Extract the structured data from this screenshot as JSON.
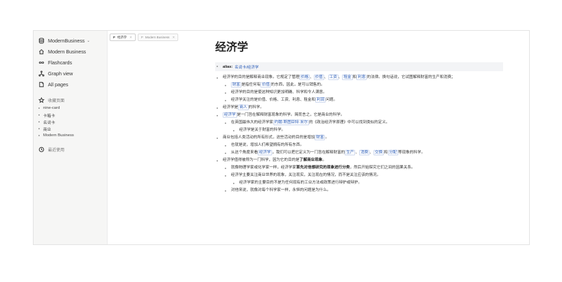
{
  "sidebar": {
    "workspace": "ModernBusiness",
    "items": [
      {
        "label": "Modern Business",
        "icon": "home-icon"
      },
      {
        "label": "Flashcards",
        "icon": "infinity-icon"
      },
      {
        "label": "Graph view",
        "icon": "graph-icon"
      },
      {
        "label": "All pages",
        "icon": "pages-icon"
      }
    ],
    "favorites_label": "收藏页面",
    "favorites": [
      "nine-card",
      "卡箱卡",
      "名词卡",
      "商业",
      "Modern Business"
    ],
    "recent_label": "最近使用"
  },
  "tabs": [
    {
      "prefix": "P",
      "label": "经济学",
      "active": true
    },
    {
      "prefix": "P",
      "label": "Modern Business",
      "active": false
    }
  ],
  "page": {
    "title": "经济学",
    "alias_key": "alias:",
    "alias_value": "名词卡/经济学",
    "blocks": [
      {
        "level": 0,
        "parts": [
          {
            "t": "经济学的目的是解释商业现象。它规定了管理"
          },
          {
            "t": "价格",
            "link": true
          },
          {
            "t": "、"
          },
          {
            "t": "价值",
            "link": true
          },
          {
            "t": "、"
          },
          {
            "t": "工资",
            "link": true
          },
          {
            "t": "、"
          },
          {
            "t": "租金",
            "link": true
          },
          {
            "t": "和"
          },
          {
            "t": "利息",
            "link": true
          },
          {
            "t": "的法律。换句话说，它试图解释财富的生产和消费；"
          }
        ]
      },
      {
        "level": 1,
        "parts": [
          {
            "t": "财富",
            "link": true
          },
          {
            "t": "是指任何有"
          },
          {
            "t": "价值",
            "link": true
          },
          {
            "t": "的东西，因此，是可以销售的。"
          }
        ]
      },
      {
        "level": 1,
        "parts": [
          {
            "t": "经济学的目的是使这种知识更加明确、科学和令人满意。"
          }
        ]
      },
      {
        "level": 1,
        "parts": [
          {
            "t": "经济学关注的是价值、价格、工资、利息、租金和"
          },
          {
            "t": "利润",
            "link": true
          },
          {
            "t": "问题。"
          }
        ]
      },
      {
        "level": 0,
        "parts": [
          {
            "t": "经济学是"
          },
          {
            "t": "商人",
            "link": true
          },
          {
            "t": "的科学。"
          }
        ]
      },
      {
        "level": 0,
        "parts": [
          {
            "t": "经济学",
            "link": true
          },
          {
            "t": "是一门旨在解释财富现象的科学。简而言之，它是商业的科学。"
          }
        ]
      },
      {
        "level": 1,
        "parts": [
          {
            "t": "在英国最伟大的经济学家"
          },
          {
            "t": "约翰·斯图亚特·米尔",
            "link": true
          },
          {
            "t": "的《政治经济学原理》中可以找到类似的定义。"
          }
        ]
      },
      {
        "level": 2,
        "parts": [
          {
            "t": "经济学是关于财富的科学。"
          }
        ]
      },
      {
        "level": 0,
        "parts": [
          {
            "t": "商业包括人类活动的所有形式，这些活动的目的是增加"
          },
          {
            "t": "财富",
            "link": true
          },
          {
            "t": "。"
          }
        ]
      },
      {
        "level": 1,
        "parts": [
          {
            "t": "也就是说，增加人们希望拥有的所有东西。"
          }
        ]
      },
      {
        "level": 1,
        "parts": [
          {
            "t": "从这个角度来看"
          },
          {
            "t": "经济学",
            "link": true
          },
          {
            "t": "，我们可以把它定义为一门旨在解释财富的"
          },
          {
            "t": "生产",
            "link": true
          },
          {
            "t": "、"
          },
          {
            "t": "消费",
            "link": true
          },
          {
            "t": "、"
          },
          {
            "t": "交换",
            "link": true
          },
          {
            "t": "和"
          },
          {
            "t": "分配",
            "link": true
          },
          {
            "t": "等现象的科学。"
          }
        ]
      },
      {
        "level": 0,
        "parts": [
          {
            "t": "经济学值得被称为一门科学，因为它的目的是"
          },
          {
            "t": "了解商业现象",
            "bold": true
          },
          {
            "t": "。"
          }
        ]
      },
      {
        "level": 1,
        "parts": [
          {
            "t": "就像物理学家或化学家一样，经济学家"
          },
          {
            "t": "首先对他想研究的现象进行分类",
            "bold": true
          },
          {
            "t": "，然后开始探究它们之间的因果关系。"
          }
        ]
      },
      {
        "level": 1,
        "parts": [
          {
            "t": "经济学主要关注商业世界的现象，关注现实，关注现在的情况，而不是关注应该的情况。"
          }
        ]
      },
      {
        "level": 2,
        "parts": [
          {
            "t": "经济学家的主要目的不是为任何现有的工业方法或政策进行辩护或辩护。"
          }
        ]
      },
      {
        "level": 1,
        "parts": [
          {
            "t": "对他来说，就像对每个科学家一样，永恒的问题是为什么。"
          }
        ]
      }
    ]
  }
}
